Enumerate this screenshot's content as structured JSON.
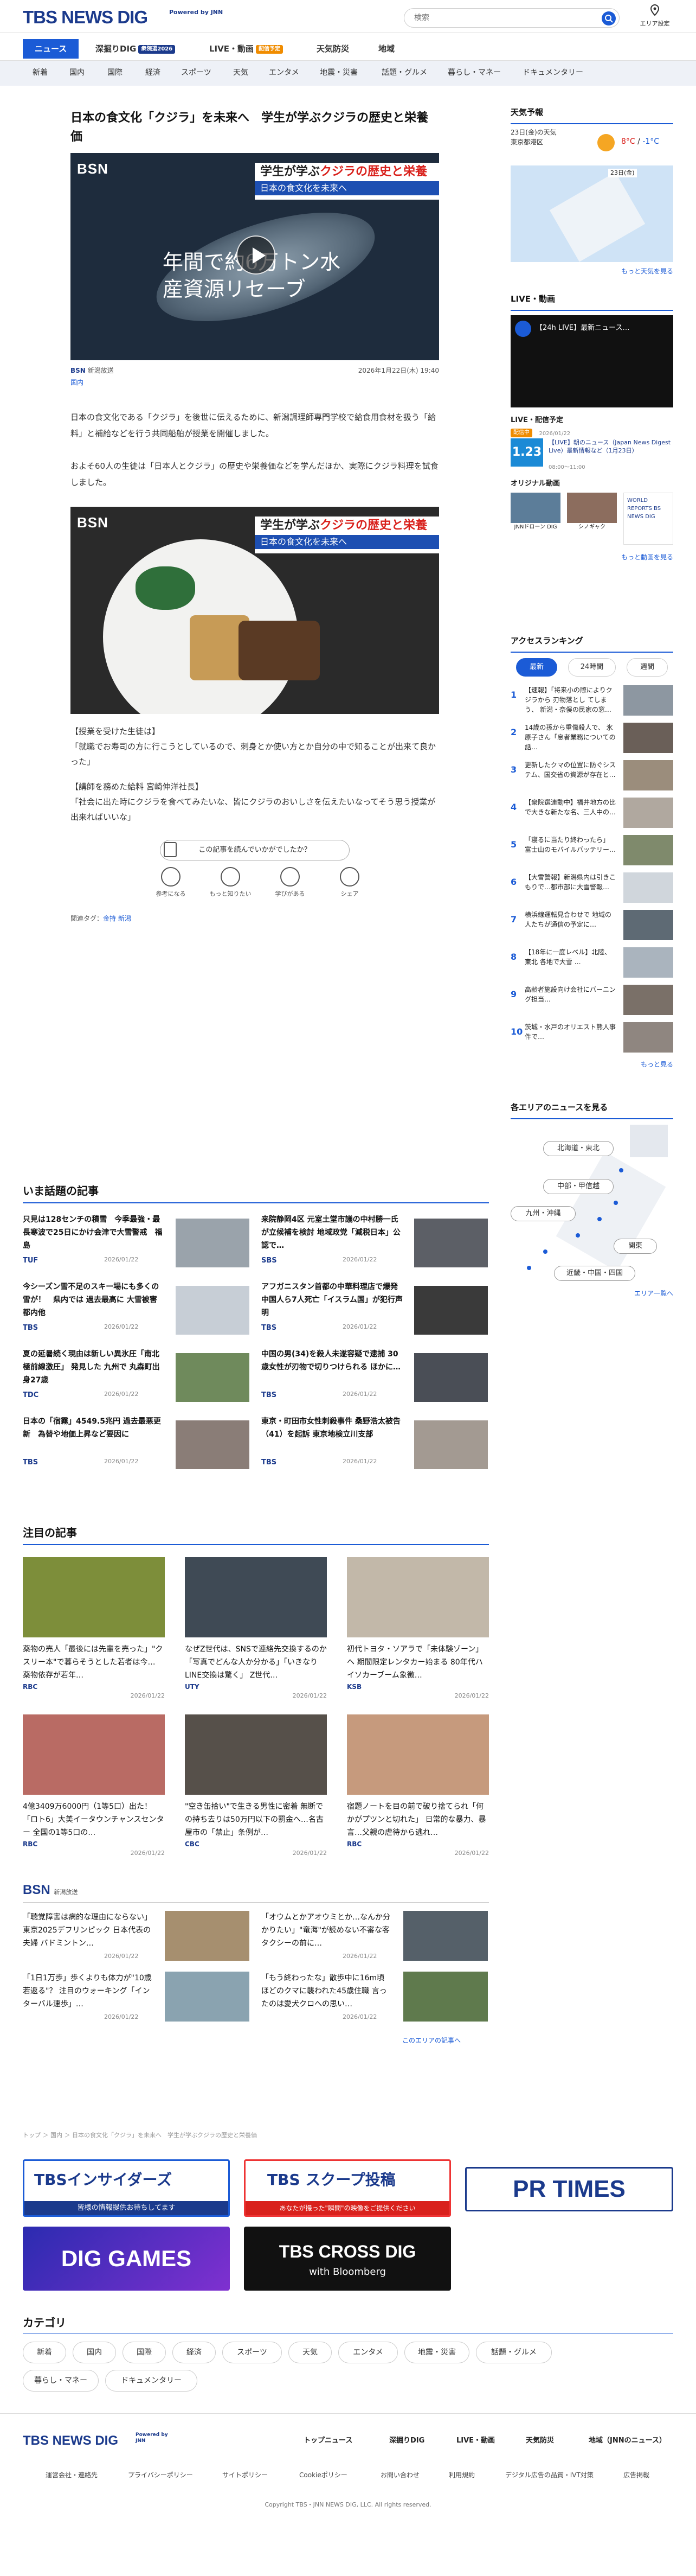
{
  "header": {
    "logo": "TBS NEWS DIG",
    "logo_sub": "Powered by JNN",
    "search_placeholder": "検索",
    "area_label": "エリア設定"
  },
  "gnav": [
    {
      "label": "ニュース"
    },
    {
      "label": "深掘りDIG",
      "badge": "衆院選2026"
    },
    {
      "label": "LIVE・動画",
      "badge": "配信予定"
    },
    {
      "label": "天気防災"
    },
    {
      "label": "地域"
    }
  ],
  "snav": [
    "新着",
    "国内",
    "国際",
    "経済",
    "スポーツ",
    "天気",
    "エンタメ",
    "地震・災害",
    "話題・グルメ",
    "暮らし・マネー",
    "ドキュメンタリー"
  ],
  "article": {
    "title": "日本の食文化「クジラ」を未来へ　学生が学ぶクジラの歴史と栄養価",
    "video_tag1a": "学生が学ぶ",
    "video_tag1b": "クジラの歴史と栄養価",
    "video_tag2": "日本の食文化を未来へ",
    "video_caption": "年間で約6万トン水産資源リセーブ",
    "source": "新潟放送",
    "date": "2026年1月22日(木) 19:40",
    "category": "国内",
    "p1": "日本の食文化である「クジラ」を後世に伝えるために、新潟調理師専門学校で給食用食材を扱う「給料」と補給などを行う共同船舶が授業を開催しました。",
    "p2": "およそ60人の生徒は「日本人とクジラ」の歴史や栄養価などを学んだほか、実際にクジラ料理を試食しました。",
    "quote1": "【授業を受けた生徒は】",
    "quote1b": "「就職でお寿司の方に行こうとしているので、刺身とか使い方とか自分の中で知ることが出来て良かった」",
    "quote2": "【講師を務めた給料 宮崎伸洋社長】",
    "quote2b": "「社会に出た時にクジラを食べてみたいな、皆にクジラのおいしさを伝えたいなってそう思う授業が出来ればいいな」",
    "feedback": "この記事を読んでいかがでしたか？",
    "reactions": [
      "参考になる",
      "もっと知りたい",
      "学びがある",
      "シェア"
    ],
    "related_label": "関連タグ：",
    "related_tags": "金持 新潟"
  },
  "trending": {
    "title": "いま話題の記事",
    "items": [
      {
        "t": "只見は128センチの積雪　今季最強・最長寒波で25日にかけ会津で大雪警戒　福島",
        "d": "2026/01/22",
        "s": "TUF"
      },
      {
        "t": "今シーズン雪不足のスキー場にも多くの雪が！　県内では 過去最高に 大雪被害 都内他",
        "d": "2026/01/22",
        "s": "TBS"
      },
      {
        "t": "夏の延暑続く現由は新しい異氷圧「南北極前線激圧」 発見した 九州で 丸森町出身27歳",
        "d": "2026/01/22",
        "s": "TDC"
      },
      {
        "t": "日本の「宿霧」4549.5兆円 過去最悪更新　為替や地価上昇など要因に",
        "d": "2026/01/22",
        "s": "TBS"
      },
      {
        "t": "来院静岡4区 元室土堂市議の中村勝一氏が立候補を検討 地域政党「減税日本」公認で…",
        "d": "2026/01/22",
        "s": "SBS"
      },
      {
        "t": "アフガニスタン首都の中華料理店で爆発 中国人ら7人死亡「イスラム国」が犯行声明",
        "d": "2026/01/22",
        "s": "TBS"
      },
      {
        "t": "中国の男(34)を殺人未遂容疑で逮捕 30歳女性が刃物で切りつけられる ほかに…",
        "d": "2026/01/22",
        "s": "TBS"
      },
      {
        "t": "東京・町田市女性刺殺事件 桑野浩太被告（41）を起訴 東京地検立川支部",
        "d": "2026/01/22",
        "s": "TBS"
      }
    ]
  },
  "featured": {
    "title": "注目の記事",
    "items": [
      {
        "t": "薬物の売人「最後には先輩を売った」\"クスリー本\"で暮らそうとした若者は今… 薬物依存が若年…",
        "d": "2026/01/22",
        "s": "RBC"
      },
      {
        "t": "なぜZ世代は、SNSで連絡先交換するのか「写真でどんな人か分かる」「いきなりLINE交換は驚く」 Z世代…",
        "d": "2026/01/22",
        "s": "UTY"
      },
      {
        "t": "初代トヨタ・ソアラで「未体験ゾーン」へ 期間限定レンタカー始まる 80年代ハイソカーブーム象徴…",
        "d": "2026/01/22",
        "s": "KSB"
      },
      {
        "t": "4億3409万6000円（1等5口）出た！「ロト6」大美イータウンチャンスセンター 全国の1等5口の…",
        "d": "2026/01/22",
        "s": "RBC"
      },
      {
        "t": "\"空き缶拾い\"で生きる男性に密着 無断での持ち去りは50万円以下の罰金へ…名古屋市の「禁止」条例が…",
        "d": "2026/01/22",
        "s": "CBC"
      },
      {
        "t": "宿題ノートを目の前で破り捨てられ「何かがプツンと切れた」 日常的な暴力、暴言…父親の虐待から逃れ…",
        "d": "2026/01/22",
        "s": "RBC"
      }
    ]
  },
  "local": {
    "station": "新潟放送",
    "more": "このエリアの記事へ",
    "items": [
      {
        "t": "「聴覚障害は病的な理由にならない」東京2025デフリンピック 日本代表の夫婦 バドミントン…",
        "d": "2026/01/22"
      },
      {
        "t": "「オウムとかアオウミとか…なんか分かりたい」\"竜海\"が読めない不審な客 タクシーの前に…",
        "d": "2026/01/22"
      },
      {
        "t": "「1日1万歩」歩くよりも体力が\"10歳若返る\"？ 注目のウォーキング「インターバル速歩」…",
        "d": "2026/01/22"
      },
      {
        "t": "「もう終わったな」散歩中に16m頃ほどのクマに襲われた45歳住職 言ったのは愛犬クロへの思い…",
        "d": "2026/01/22"
      }
    ]
  },
  "breadcrumb": "トップ ＞ 国内 ＞ 日本の食文化「クジラ」を未来へ　学生が学ぶクジラの歴史と栄養価",
  "banners": [
    {
      "label": "TBSインサイダーズ",
      "sub": "皆様の情報提供お待ちしてます"
    },
    {
      "label": "TBS スクープ投稿",
      "sub": "あなたが撮った\"瞬間\"の映像をご提供ください"
    },
    {
      "label": "PR TIMES"
    },
    {
      "label": "DIG GAMES"
    },
    {
      "label": "TBS CROSS DIG",
      "sub": "with Bloomberg"
    }
  ],
  "categories": {
    "title": "カテゴリ",
    "items": [
      "新着",
      "国内",
      "国際",
      "経済",
      "スポーツ",
      "天気",
      "エンタメ",
      "地震・災害",
      "話題・グルメ",
      "暮らし・マネー",
      "ドキュメンタリー"
    ]
  },
  "sidebar": {
    "weather": {
      "title": "天気予報",
      "date": "23日(金)の天気",
      "city": "東京都港区",
      "temp_hi": "8°C",
      "temp_lo": "-1°C",
      "map_label": "23日(金)",
      "more": "もっと天気を見る"
    },
    "live": {
      "title": "LIVE・動画",
      "live_caption": "【24h LIVE】最新ニュース…",
      "sched_title": "LIVE・配信予定",
      "sched_badge": "配信中",
      "sched_date": "2026/01/22",
      "sched_num": "1.23",
      "sched_text": "【LIVE】朝のニュース（Japan News Digest Live）最新情報など（1月23日）",
      "sched_time": "08:00～11:00",
      "orig_title": "オリジナル動画",
      "orig": [
        "JNNドローン DIG",
        "シノギャク",
        "WORLD REPORTS BS NEWS DIG"
      ],
      "more": "もっと動画を見る"
    },
    "ranking": {
      "title": "アクセスランキング",
      "tabs": [
        "最新",
        "24時間",
        "週間"
      ],
      "items": [
        "【速報】「将来小の際によりクジラから 刃物落とし てしまう、 新潟・奈俣の民家の窓…",
        "14歳の孫から重傷殺人で、 氷原子さん「息者業務についての話…",
        "更新したクマの位置に防ぐシステム、国交省の資源が存在と…",
        "【衆院選連動中】福井地方の比で大きな新たな名、三人中の…",
        "「寝るに当たり終わったら」 富士山のモバイルバッテリー…",
        "【大雪警報】新潟県内は引きこもりで…都市部に大雪警報…",
        "横浜線運転見合わせで 地域の人たちが通信の予定に…",
        "【18年に一度レベル】北陸、東北 各地で大雪 …",
        "高齢者施設向け会社にバーニング担当…",
        "茨城・水戸のオリエスト熊人事件で…"
      ],
      "more": "もっと見る"
    },
    "areas": {
      "title": "各エリアのニュースを見る",
      "items": [
        "北海道・東北",
        "中部・甲信越",
        "九州・沖縄",
        "関東",
        "近畿・中国・四国"
      ],
      "more": "エリア一覧へ"
    }
  },
  "footer": {
    "logo": "TBS NEWS DIG",
    "logo_sub": "Powered by JNN",
    "nav": [
      "トップニュース",
      "深掘りDIG",
      "LIVE・動画",
      "天気防災",
      "地域（JNNのニュース）"
    ],
    "links": [
      "運営会社・連絡先",
      "プライバシーポリシー",
      "サイトポリシー",
      "Cookieポリシー",
      "お問い合わせ",
      "利用規約",
      "デジタル広告の品質・IVT対策",
      "広告掲載"
    ],
    "copyright": "Copyright TBS・JNN NEWS DIG, LLC. All rights reserved."
  },
  "colors": {
    "brand": "#1b3a8c",
    "accent": "#1b5bd6",
    "red": "#d9211c",
    "orange": "#f08c00"
  }
}
